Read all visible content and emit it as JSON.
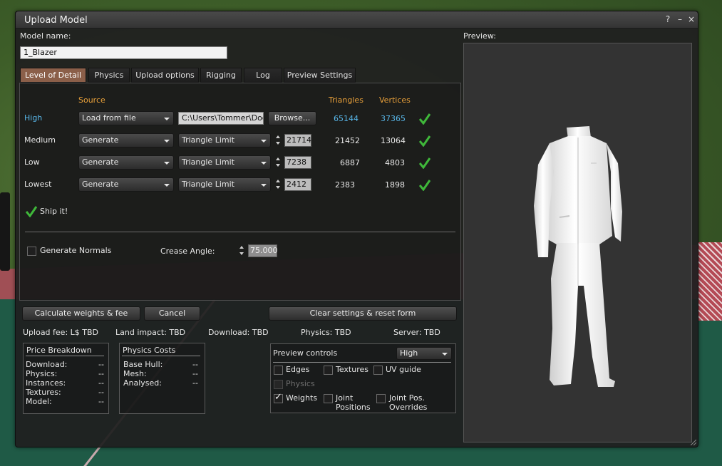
{
  "window": {
    "title": "Upload Model",
    "help_glyph": "?",
    "minimize_glyph": "–",
    "close_glyph": "×"
  },
  "model_name": {
    "label": "Model name:",
    "value": "1_Blazer"
  },
  "tabs": [
    {
      "label": "Level of Detail",
      "active": true
    },
    {
      "label": "Physics",
      "active": false
    },
    {
      "label": "Upload options",
      "active": false
    },
    {
      "label": "Rigging",
      "active": false
    },
    {
      "label": "Log",
      "active": false
    },
    {
      "label": "Preview Settings",
      "active": false
    }
  ],
  "lod": {
    "headers": {
      "source": "Source",
      "triangles": "Triangles",
      "vertices": "Vertices"
    },
    "rows": [
      {
        "name": "High",
        "source": "Load from file",
        "file_path": "C:\\Users\\Tommer\\Doc",
        "browse_label": "Browse...",
        "triangles": "65144",
        "vertices": "37365",
        "highlight": true
      },
      {
        "name": "Medium",
        "source": "Generate",
        "method": "Triangle Limit",
        "limit": "21714",
        "triangles": "21452",
        "vertices": "13064"
      },
      {
        "name": "Low",
        "source": "Generate",
        "method": "Triangle Limit",
        "limit": "7238",
        "triangles": "6887",
        "vertices": "4803"
      },
      {
        "name": "Lowest",
        "source": "Generate",
        "method": "Triangle Limit",
        "limit": "2412",
        "triangles": "2383",
        "vertices": "1898"
      }
    ],
    "ship_it": "Ship it!",
    "generate_normals": "Generate Normals",
    "crease_angle_label": "Crease Angle:",
    "crease_angle_value": "75.000"
  },
  "actions": {
    "calculate": "Calculate weights & fee",
    "cancel": "Cancel",
    "clear": "Clear settings & reset form"
  },
  "fees": {
    "upload_fee": "Upload fee: L$ TBD",
    "land_impact": "Land impact: TBD",
    "download": "Download: TBD",
    "physics": "Physics: TBD",
    "server": "Server: TBD"
  },
  "price_breakdown": {
    "title": "Price Breakdown",
    "items": [
      {
        "label": "Download:",
        "value": "--"
      },
      {
        "label": "Physics:",
        "value": "--"
      },
      {
        "label": "Instances:",
        "value": "--"
      },
      {
        "label": "Textures:",
        "value": "--"
      },
      {
        "label": "Model:",
        "value": "--"
      }
    ]
  },
  "physics_costs": {
    "title": "Physics Costs",
    "items": [
      {
        "label": "Base Hull:",
        "value": "--"
      },
      {
        "label": "Mesh:",
        "value": "--"
      },
      {
        "label": "Analysed:",
        "value": "--"
      }
    ]
  },
  "preview_controls": {
    "title": "Preview controls",
    "lod_select": "High",
    "edges": "Edges",
    "textures": "Textures",
    "uv_guide": "UV guide",
    "physics": "Physics",
    "weights": "Weights",
    "joint_positions_1": "Joint",
    "joint_positions_2": "Positions",
    "joint_overrides_1": "Joint Pos.",
    "joint_overrides_2": "Overrides"
  },
  "preview": {
    "label": "Preview:"
  },
  "colors": {
    "accent_orange": "#e8a03a",
    "accent_blue": "#58b6e8",
    "active_tab": "#8b5f49",
    "check_green": "#3fb83a"
  }
}
